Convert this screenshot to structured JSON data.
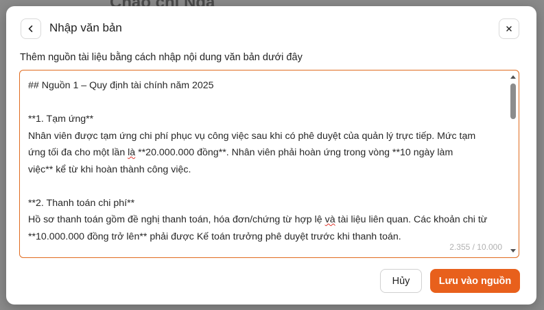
{
  "background": {
    "page_title": "Chào chị Nga"
  },
  "modal": {
    "title": "Nhập văn bản",
    "back_icon": "chevron-left-icon",
    "close_icon": "close-icon",
    "instruction": "Thêm nguồn tài liệu bằng cách nhập nội dung văn bản dưới đây",
    "textarea": {
      "lines": [
        "## Nguồn 1 – Quy định tài chính năm 2025",
        "",
        "**1. Tạm ứng**",
        "Nhân viên được tạm ứng chi phí phục vụ công việc sau khi có phê duyệt của quản lý trực tiếp. Mức tạm",
        "ứng tối đa cho một lần là **20.000.000 đồng**. Nhân viên phải hoàn ứng trong vòng **10 ngày làm",
        "việc** kể từ khi hoàn thành công việc.",
        "",
        "**2. Thanh toán chi phí**",
        "Hồ sơ thanh toán gồm đề nghị thanh toán, hóa đơn/chứng từ hợp lệ và tài liệu liên quan. Các khoản chi từ",
        "**10.000.000 đồng trở lên** phải được Kế toán trưởng phê duyệt trước khi thanh toán."
      ],
      "char_count": "2.355 / 10.000"
    },
    "buttons": {
      "cancel": "Hủy",
      "save": "Lưu vào nguồn"
    }
  },
  "colors": {
    "accent": "#e8601c",
    "textarea_border": "#e06a1d",
    "overlay": "#8a8a8a"
  }
}
